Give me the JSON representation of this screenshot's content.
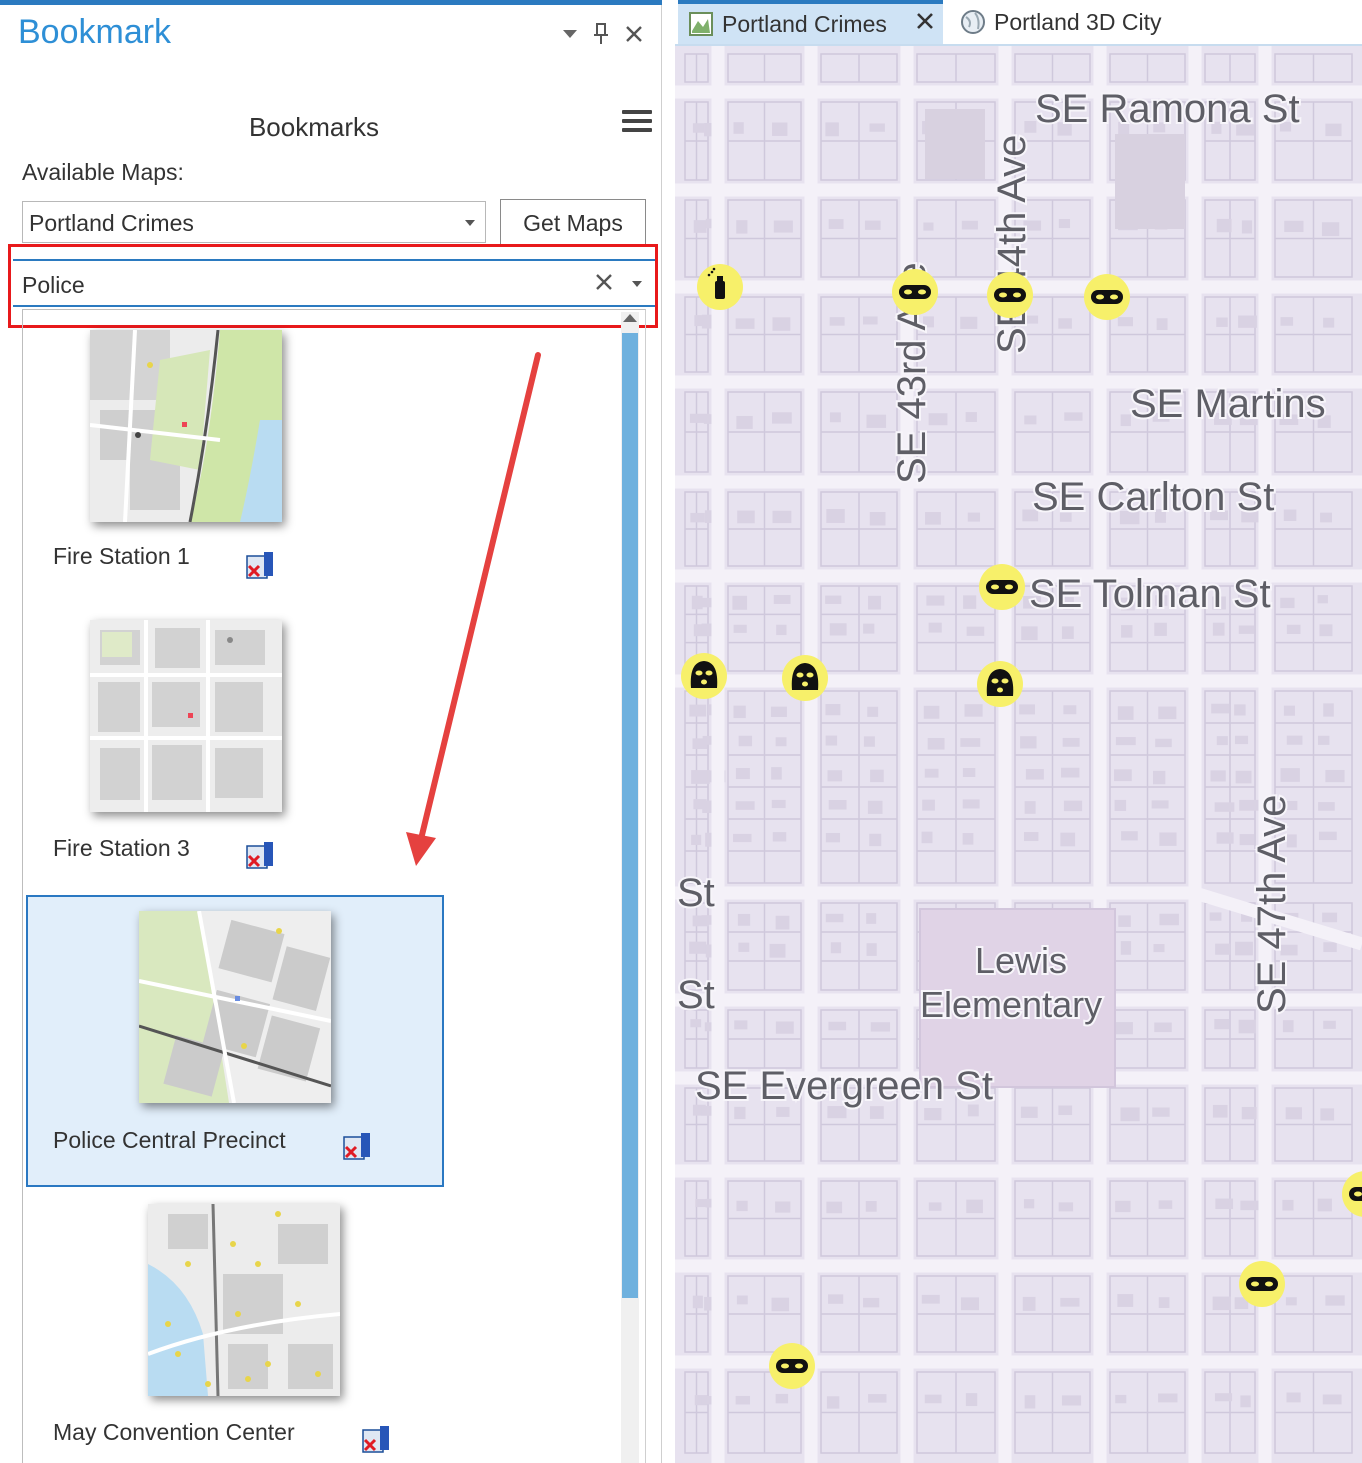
{
  "pane": {
    "title": "Bookmark",
    "heading": "Bookmarks",
    "available_label": "Available Maps:",
    "map_select_value": "Portland Crimes",
    "get_maps_label": "Get Maps",
    "filter_value": "Police"
  },
  "bookmarks": [
    {
      "name": "Fire Station 1",
      "selected": false
    },
    {
      "name": "Fire Station 3",
      "selected": false
    },
    {
      "name": "Police Central Precinct",
      "selected": true
    },
    {
      "name": "May Convention Center",
      "selected": false
    }
  ],
  "tabs": [
    {
      "label": "Portland Crimes",
      "active": true
    },
    {
      "label": "Portland 3D City",
      "active": false
    }
  ],
  "map_labels": [
    "SE Ramona St",
    "SE 44th Ave",
    "SE 43rd Ave",
    "SE Martins",
    "SE Carlton St",
    "SE Tolman St",
    "St",
    "St",
    "Lewis",
    "Elementary",
    "SE Evergreen St",
    "SE 47th Ave"
  ],
  "colors": {
    "accent": "#2b7ac0",
    "title_blue": "#2e8fd6",
    "highlight_red": "#e8191b",
    "selection_bg": "#e1eefa",
    "marker_yellow": "#f7f06a",
    "map_bg": "#e7e2ef"
  },
  "map_markers": [
    {
      "icon": "spray-can-icon"
    },
    {
      "icon": "burglar-mask-icon"
    },
    {
      "icon": "burglar-mask-icon"
    },
    {
      "icon": "burglar-mask-icon"
    },
    {
      "icon": "burglar-mask-icon"
    },
    {
      "icon": "balaclava-icon"
    },
    {
      "icon": "balaclava-icon"
    },
    {
      "icon": "balaclava-icon"
    },
    {
      "icon": "burglar-mask-icon"
    },
    {
      "icon": "burglar-mask-icon"
    },
    {
      "icon": "burglar-mask-icon"
    }
  ]
}
